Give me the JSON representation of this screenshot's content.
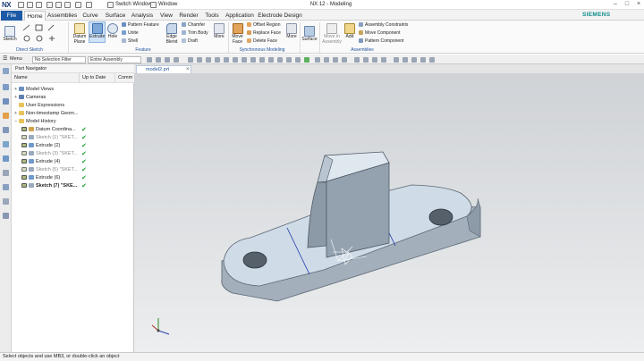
{
  "titlebar": {
    "logo": "NX",
    "switch_window": "Switch Window",
    "window_menu": "Window",
    "app_title": "NX 12 - Modeling",
    "brand": "SIEMENS"
  },
  "menubar": {
    "file": "File",
    "tabs": [
      "Home",
      "Assemblies",
      "Curve",
      "Surface",
      "Analysis",
      "View",
      "Render",
      "Tools",
      "Application",
      "Electrode Design"
    ],
    "search_value": "rotate"
  },
  "ribbon": {
    "direct_sketch": {
      "sketch": "Sketch",
      "group": "Direct Sketch"
    },
    "feature": {
      "datum_plane": "Datum Plane",
      "extrude": "Extrude",
      "hole": "Hole",
      "pattern_feature": "Pattern Feature",
      "unite": "Unite",
      "shell": "Shell",
      "edge_blend": "Edge Blend",
      "chamfer": "Chamfer",
      "trim_body": "Trim Body",
      "draft": "Draft",
      "more": "More",
      "group": "Feature"
    },
    "sync": {
      "move_face": "Move Face",
      "offset_region": "Offset Region",
      "replace_face": "Replace Face",
      "delete_face": "Delete Face",
      "more": "More",
      "group": "Synchronous Modeling"
    },
    "surface": {
      "surface": "Surface",
      "more": "More"
    },
    "assemblies": {
      "move_in_assembly": "Move in Assembly",
      "add": "Add",
      "assembly_constraints": "Assembly Constraints",
      "move_component": "Move Component",
      "pattern_component": "Pattern Component",
      "group": "Assemblies"
    }
  },
  "selbar": {
    "menu": "Menu",
    "filter": "No Selection Filter",
    "scope": "Entire Assembly"
  },
  "doc": {
    "tab": "model2.prt"
  },
  "nav": {
    "title": "Part Navigator",
    "col_name": "Name",
    "col_uptodate": "Up to Date",
    "col_comment": "Comm",
    "rows": [
      {
        "label": "Model Views",
        "check": ""
      },
      {
        "label": "Cameras",
        "check": ""
      },
      {
        "label": "User Expressions",
        "check": ""
      },
      {
        "label": "Non-timestamp Geom...",
        "check": ""
      },
      {
        "label": "Model History",
        "check": ""
      },
      {
        "label": "Datum Coordina...",
        "check": "✔"
      },
      {
        "label": "Sketch (1) \"SKET...",
        "check": "✔"
      },
      {
        "label": "Extrude (2)",
        "check": "✔"
      },
      {
        "label": "Sketch (3) \"SKET...",
        "check": "✔"
      },
      {
        "label": "Extrude (4)",
        "check": "✔"
      },
      {
        "label": "Sketch (5) \"SKET...",
        "check": "✔"
      },
      {
        "label": "Extrude (6)",
        "check": "✔"
      },
      {
        "label": "Sketch (7) \"SKE...",
        "check": "✔"
      }
    ]
  },
  "status": {
    "text": "Select objects and use MB3, or double-click an object"
  },
  "colors": {
    "accent": "#1c5aa6",
    "part_face": "#cfdbe6",
    "part_side": "#8a98a6",
    "brand": "#0e8c8c"
  }
}
